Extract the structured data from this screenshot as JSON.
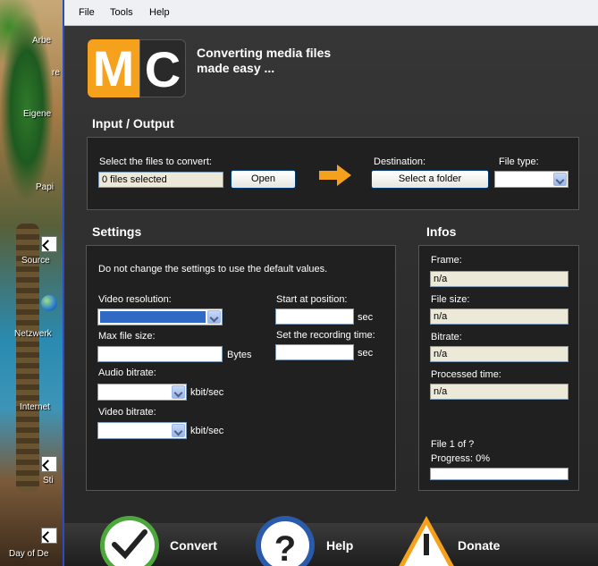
{
  "desktop": {
    "labels": [
      "Arbe",
      "re",
      "Eigene",
      "Papi",
      "Source",
      "Netzwerk",
      "Internet",
      "Sti",
      "Day of De"
    ]
  },
  "menu": {
    "items": [
      "File",
      "Tools",
      "Help"
    ]
  },
  "logo": {
    "m": "M",
    "c": "C"
  },
  "tagline": {
    "line1": "Converting media files",
    "line2": "made easy ..."
  },
  "io": {
    "title": "Input / Output",
    "select_label": "Select the files to convert:",
    "files_value": "0 files selected",
    "open_button": "Open",
    "destination_label": "Destination:",
    "folder_button": "Select a folder",
    "filetype_label": "File type:",
    "filetype_value": ""
  },
  "settings": {
    "title": "Settings",
    "hint": "Do not change the settings to use the default values.",
    "video_resolution_label": "Video resolution:",
    "max_file_size_label": "Max file size:",
    "bytes_unit": "Bytes",
    "audio_bitrate_label": "Audio bitrate:",
    "kbits_unit_1": "kbit/sec",
    "video_bitrate_label": "Video bitrate:",
    "kbits_unit_2": "kbit/sec",
    "start_label": "Start at position:",
    "sec_unit_1": "sec",
    "recording_label": "Set the recording time:",
    "sec_unit_2": "sec"
  },
  "infos": {
    "title": "Infos",
    "frame_label": "Frame:",
    "frame_value": "n/a",
    "filesize_label": "File size:",
    "filesize_value": "n/a",
    "bitrate_label": "Bitrate:",
    "bitrate_value": "n/a",
    "processed_label": "Processed time:",
    "processed_value": "n/a",
    "file_count": "File 1 of ?",
    "progress_text": "Progress: 0%",
    "progress": 0
  },
  "actions": {
    "convert": "Convert",
    "help": "Help",
    "donate": "Donate"
  },
  "colors": {
    "accent": "#f5a11c",
    "window_border": "#2a4cc4",
    "selection": "#316ac5"
  }
}
